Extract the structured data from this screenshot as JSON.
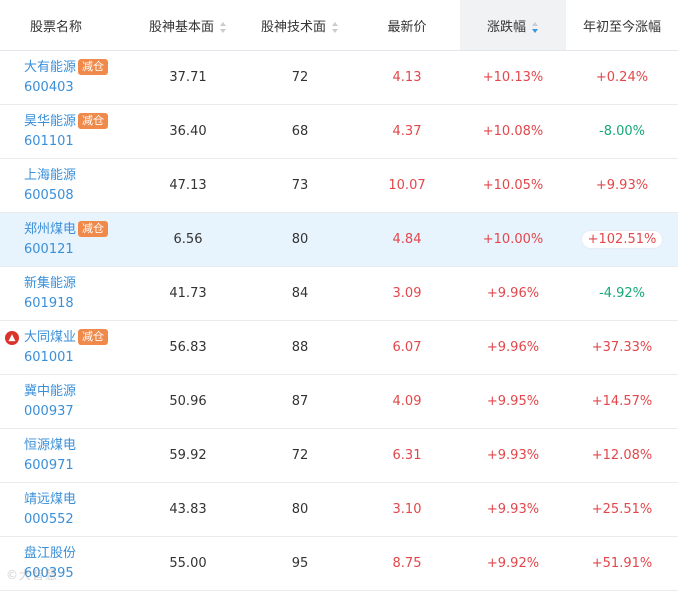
{
  "headers": {
    "name": "股票名称",
    "fundamental": "股神基本面",
    "technical": "股神技术面",
    "price": "最新价",
    "change": "涨跌幅",
    "ytd": "年初至今涨幅"
  },
  "rows": [
    {
      "name": "大有能源",
      "code": "600403",
      "badge": "减仓",
      "fundamental": "37.71",
      "technical": "72",
      "price": "4.13",
      "change": "+10.13%",
      "ytd": "+0.24%"
    },
    {
      "name": "昊华能源",
      "code": "601101",
      "badge": "减仓",
      "fundamental": "36.40",
      "technical": "68",
      "price": "4.37",
      "change": "+10.08%",
      "ytd": "-8.00%"
    },
    {
      "name": "上海能源",
      "code": "600508",
      "badge": "",
      "fundamental": "47.13",
      "technical": "73",
      "price": "10.07",
      "change": "+10.05%",
      "ytd": "+9.93%"
    },
    {
      "name": "郑州煤电",
      "code": "600121",
      "badge": "减仓",
      "fundamental": "6.56",
      "technical": "80",
      "price": "4.84",
      "change": "+10.00%",
      "ytd": "+102.51%"
    },
    {
      "name": "新集能源",
      "code": "601918",
      "badge": "",
      "fundamental": "41.73",
      "technical": "84",
      "price": "3.09",
      "change": "+9.96%",
      "ytd": "-4.92%"
    },
    {
      "name": "大同煤业",
      "code": "601001",
      "badge": "减仓",
      "fundamental": "56.83",
      "technical": "88",
      "price": "6.07",
      "change": "+9.96%",
      "ytd": "+37.33%",
      "hot": true
    },
    {
      "name": "冀中能源",
      "code": "000937",
      "badge": "",
      "fundamental": "50.96",
      "technical": "87",
      "price": "4.09",
      "change": "+9.95%",
      "ytd": "+14.57%"
    },
    {
      "name": "恒源煤电",
      "code": "600971",
      "badge": "",
      "fundamental": "59.92",
      "technical": "72",
      "price": "6.31",
      "change": "+9.93%",
      "ytd": "+12.08%"
    },
    {
      "name": "靖远煤电",
      "code": "000552",
      "badge": "",
      "fundamental": "43.83",
      "technical": "80",
      "price": "3.10",
      "change": "+9.93%",
      "ytd": "+25.51%"
    },
    {
      "name": "盘江股份",
      "code": "600395",
      "badge": "",
      "fundamental": "55.00",
      "technical": "95",
      "price": "8.75",
      "change": "+9.92%",
      "ytd": "+51.91%"
    }
  ],
  "highlighted_row": 3,
  "watermark": "©大智慧",
  "colors": {
    "up": "#e2474b",
    "down": "#17a877",
    "link": "#3a8fd9",
    "badge": "#f08a4b",
    "highlight": "#e8f4fd"
  }
}
